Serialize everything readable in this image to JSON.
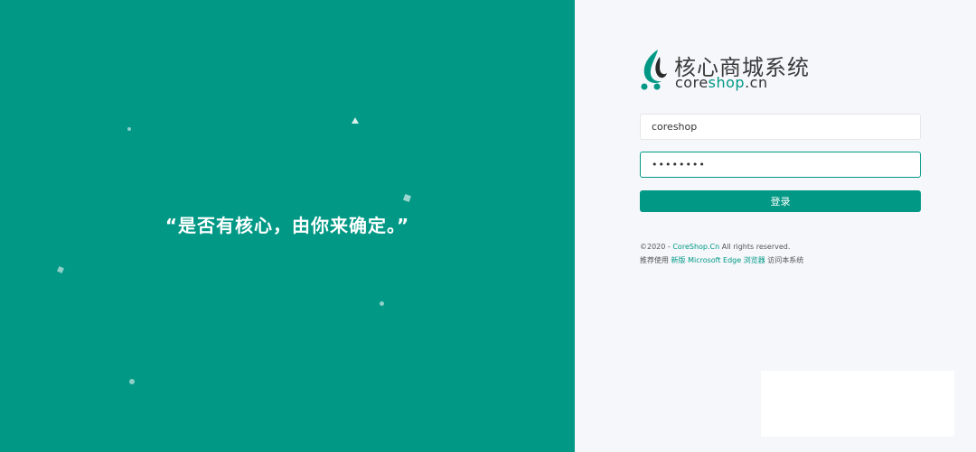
{
  "left": {
    "slogan": "“是否有核心，由你来确定。”"
  },
  "brand": {
    "title": "核心商城系统",
    "sub_prefix": "core",
    "sub_accent": "shop",
    "sub_suffix": ".cn",
    "accent_color": "#019885"
  },
  "form": {
    "username_value": "coreshop",
    "password_value": "coreshop",
    "login_label": "登录"
  },
  "footer": {
    "copyright_prefix": "©2020 - ",
    "copyright_link": "CoreShop.Cn",
    "copyright_suffix": " All rights reserved.",
    "recommend_prefix": "推荐使用 ",
    "recommend_link": "新版 Microsoft Edge 浏览器",
    "recommend_suffix": " 访问本系统"
  },
  "colors": {
    "primary": "#019885",
    "background": "#f5f7fb"
  }
}
